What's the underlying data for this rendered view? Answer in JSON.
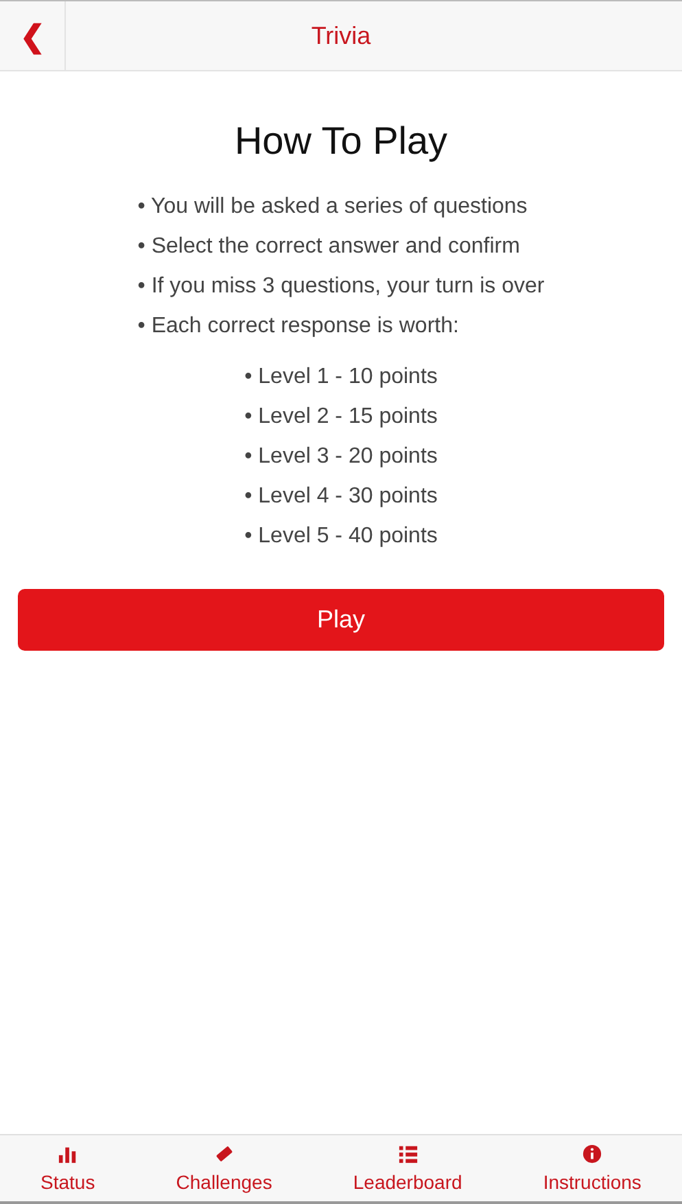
{
  "header": {
    "back_icon": "❮",
    "title": "Trivia"
  },
  "content": {
    "heading": "How To Play",
    "rules": [
      "• You will be asked a series of questions",
      "• Select the correct answer and confirm",
      "• If you miss 3 questions, your turn is over",
      "• Each correct response is worth:"
    ],
    "levels": [
      "• Level 1 - 10 points",
      "• Level 2 - 15 points",
      "• Level 3 - 20 points",
      "• Level 4 - 30 points",
      "• Level 5 - 40 points"
    ],
    "play_button": "Play"
  },
  "tab_bar": [
    {
      "kind": "chart",
      "label": "Status"
    },
    {
      "kind": "ticket",
      "label": "Challenges"
    },
    {
      "kind": "list",
      "label": "Leaderboard"
    },
    {
      "kind": "info",
      "label": "Instructions"
    }
  ]
}
